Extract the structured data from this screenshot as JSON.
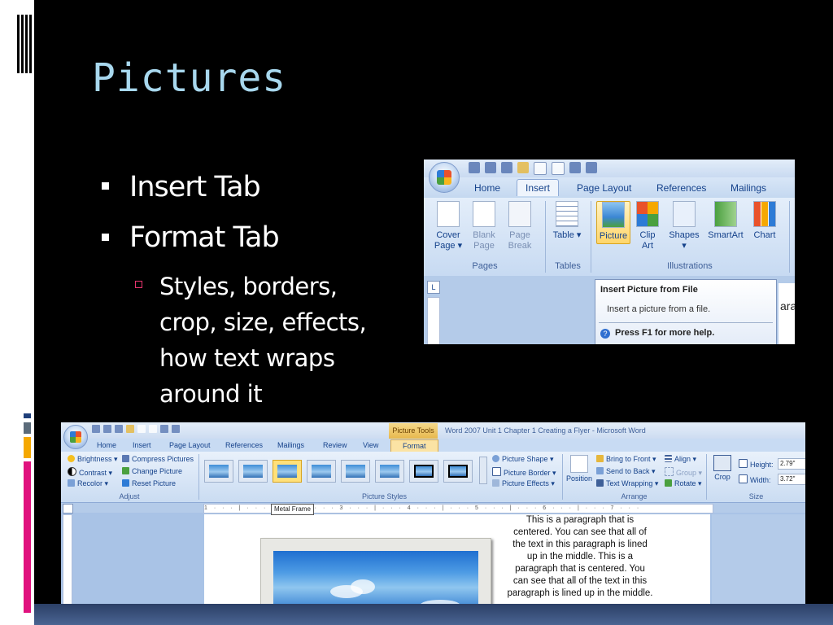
{
  "slide": {
    "title": "Pictures",
    "bullets": [
      "Insert Tab",
      "Format Tab"
    ],
    "sub_bullet": "Styles, borders, crop, size, effects, how text wraps around it"
  },
  "colors": {
    "title": "#a8d8ee",
    "sub_bullet_marker": "#e8356f",
    "accent_marks": [
      "#1f3f7a",
      "#f5a800",
      "#e0127e"
    ]
  },
  "insert_ribbon": {
    "tabs": [
      "Home",
      "Insert",
      "Page Layout",
      "References",
      "Mailings"
    ],
    "active_tab": "Insert",
    "groups": {
      "pages": "Pages",
      "tables": "Tables",
      "illustrations": "Illustrations"
    },
    "buttons": {
      "cover_page": "Cover Page ▾",
      "blank_page": "Blank Page",
      "page_break": "Page Break",
      "table": "Table ▾",
      "picture": "Picture",
      "clip_art": "Clip Art",
      "shapes": "Shapes ▾",
      "smartart": "SmartArt",
      "chart": "Chart"
    },
    "ruler_box": "L",
    "page_text": "ara",
    "tooltip": {
      "title": "Insert Picture from File",
      "body": "Insert a picture from a file.",
      "help": "Press F1 for more help."
    }
  },
  "format_ribbon": {
    "picture_tools": "Picture Tools",
    "window_title": "Word 2007 Unit 1 Chapter 1 Creating a Flyer - Microsoft Word",
    "tabs": [
      "Home",
      "Insert",
      "Page Layout",
      "References",
      "Mailings",
      "Review",
      "View",
      "Format"
    ],
    "active_tab": "Format",
    "adjust": {
      "brightness": "Brightness ▾",
      "contrast": "Contrast ▾",
      "recolor": "Recolor ▾",
      "compress": "Compress Pictures",
      "change": "Change Picture",
      "reset": "Reset Picture",
      "label": "Adjust"
    },
    "styles": {
      "shape": "Picture Shape ▾",
      "border": "Picture Border ▾",
      "effects": "Picture Effects ▾",
      "label": "Picture Styles"
    },
    "arrange": {
      "position": "Position",
      "bring_front": "Bring to Front ▾",
      "send_back": "Send to Back ▾",
      "text_wrapping": "Text Wrapping ▾",
      "align": "Align ▾",
      "group": "Group ▾",
      "rotate": "Rotate ▾",
      "label": "Arrange"
    },
    "size": {
      "crop": "Crop",
      "height_label": "Height:",
      "height_value": "2.79\"",
      "width_label": "Width:",
      "width_value": "3.72\"",
      "label": "Size"
    },
    "metal_frame_tip": "Metal Frame",
    "ruler_text": "1 · · · | · · · 2 · · · | · · · 3 · · · | · · · 4 · · · | · · · 5 · · · | · · · 6 · · · | · · · 7 · · ·",
    "paragraph": "This is a paragraph that is centered. You can see that all of the text in this paragraph is lined up in the middle. This is a paragraph that is centered. You can see that all of the text in this paragraph is lined up in the middle."
  }
}
